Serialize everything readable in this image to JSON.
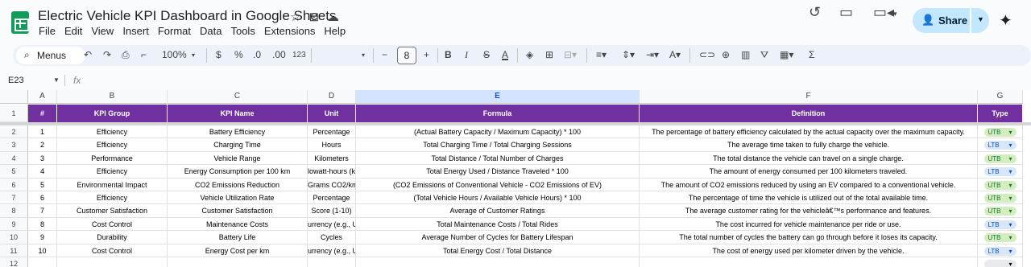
{
  "title": "Electric Vehicle KPI Dashboard in Google Sheets",
  "menu": [
    "File",
    "Edit",
    "View",
    "Insert",
    "Format",
    "Data",
    "Tools",
    "Extensions",
    "Help"
  ],
  "share_label": "Share",
  "toolbar": {
    "menus_label": "Menus",
    "zoom": "100%",
    "currency": "$",
    "percent": "%",
    "dec_decrease": ".0",
    "dec_increase": ".00",
    "number_format": "123",
    "font_size": "8"
  },
  "name_box": "E23",
  "fx_label": "fx",
  "columns": [
    {
      "letter": "A",
      "selected": false
    },
    {
      "letter": "B",
      "selected": false
    },
    {
      "letter": "C",
      "selected": false
    },
    {
      "letter": "D",
      "selected": false
    },
    {
      "letter": "E",
      "selected": true
    },
    {
      "letter": "F",
      "selected": false
    },
    {
      "letter": "G",
      "selected": false
    }
  ],
  "headers": [
    "#",
    "KPI Group",
    "KPI Name",
    "Unit",
    "Formula",
    "Definition",
    "Type"
  ],
  "rows": [
    {
      "n": "1",
      "group": "Efficiency",
      "name": "Battery Efficiency",
      "unit": "Percentage",
      "formula": "(Actual Battery Capacity / Maximum Capacity) * 100",
      "definition": "The percentage of battery efficiency calculated by the actual capacity over the maximum capacity.",
      "type": "UTB"
    },
    {
      "n": "2",
      "group": "Efficiency",
      "name": "Charging Time",
      "unit": "Hours",
      "formula": "Total Charging Time / Total Charging Sessions",
      "definition": "The average time taken to fully charge the vehicle.",
      "type": "LTB"
    },
    {
      "n": "3",
      "group": "Performance",
      "name": "Vehicle Range",
      "unit": "Kilometers",
      "formula": "Total Distance / Total Number of Charges",
      "definition": "The total distance the vehicle can travel on a single charge.",
      "type": "UTB"
    },
    {
      "n": "4",
      "group": "Efficiency",
      "name": "Energy Consumption per 100 km",
      "unit": "lowatt-hours (kW",
      "formula": "Total Energy Used / Distance Traveled * 100",
      "definition": "The amount of energy consumed per 100 kilometers traveled.",
      "type": "LTB"
    },
    {
      "n": "5",
      "group": "Environmental Impact",
      "name": "CO2 Emissions Reduction",
      "unit": "Grams CO2/km",
      "formula": "(CO2 Emissions of Conventional Vehicle - CO2 Emissions of EV)",
      "definition": "The amount of CO2 emissions reduced by using an EV compared to a conventional vehicle.",
      "type": "UTB"
    },
    {
      "n": "6",
      "group": "Efficiency",
      "name": "Vehicle Utilization Rate",
      "unit": "Percentage",
      "formula": "(Total Vehicle Hours / Available Vehicle Hours) * 100",
      "definition": "The percentage of time the vehicle is utilized out of the total available time.",
      "type": "UTB"
    },
    {
      "n": "7",
      "group": "Customer Satisfaction",
      "name": "Customer Satisfaction",
      "unit": "Score (1-10)",
      "formula": "Average of Customer Ratings",
      "definition": "The average customer rating for the vehicleâ€™s performance and features.",
      "type": "UTB"
    },
    {
      "n": "8",
      "group": "Cost Control",
      "name": "Maintenance Costs",
      "unit": "urrency (e.g., US",
      "formula": "Total Maintenance Costs / Total Rides",
      "definition": "The cost incurred for vehicle maintenance per ride or use.",
      "type": "LTB"
    },
    {
      "n": "9",
      "group": "Durability",
      "name": "Battery Life",
      "unit": "Cycles",
      "formula": "Average Number of Cycles for Battery Lifespan",
      "definition": "The total number of cycles the battery can go through before it loses its capacity.",
      "type": "UTB"
    },
    {
      "n": "10",
      "group": "Cost Control",
      "name": "Energy Cost per km",
      "unit": "urrency (e.g., US",
      "formula": "Total Energy Cost / Total Distance",
      "definition": "The cost of energy used per kilometer driven by the vehicle.",
      "type": "LTB"
    }
  ],
  "colors": {
    "header_bg": "#7030a0",
    "utb_chip": "#d4edbc",
    "ltb_chip": "#d7e6f9",
    "share_bg": "#c2e7ff"
  }
}
